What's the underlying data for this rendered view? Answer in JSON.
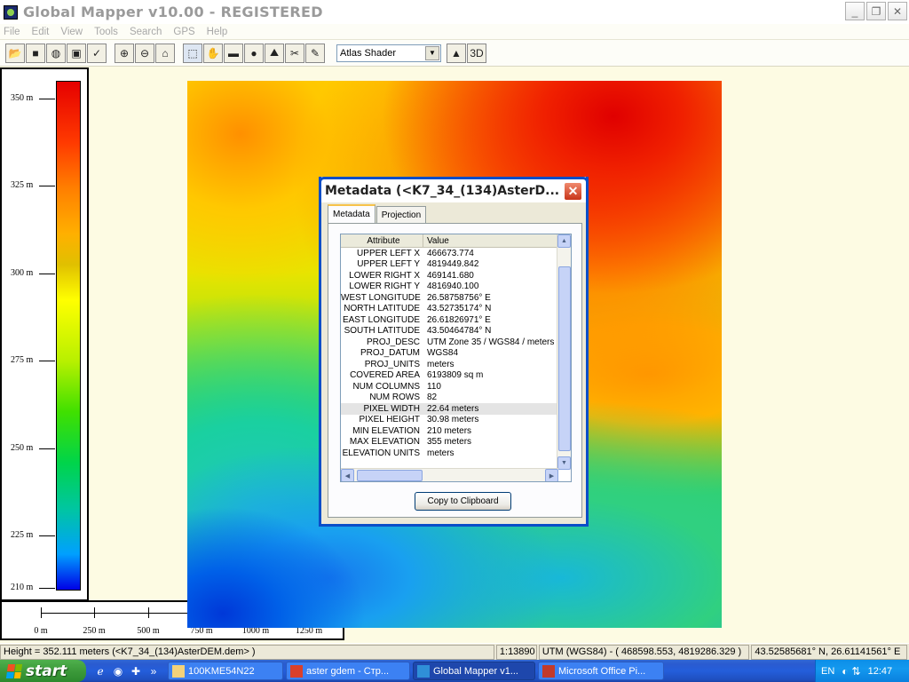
{
  "window": {
    "title": "Global Mapper v10.00 - REGISTERED",
    "buttons": [
      "_",
      "❐",
      "✕"
    ]
  },
  "menu": [
    "File",
    "Edit",
    "View",
    "Tools",
    "Search",
    "GPS",
    "Help"
  ],
  "toolbar": {
    "shader": "Atlas Shader"
  },
  "legend": {
    "labels": [
      "350 m",
      "325 m",
      "300 m",
      "275 m",
      "250 m",
      "225 m",
      "210 m"
    ]
  },
  "scale": {
    "labels": [
      "0 m",
      "250 m",
      "500 m",
      "750 m",
      "1000 m",
      "1250 m"
    ]
  },
  "dialog": {
    "title": "Metadata (<K7_34_(134)AsterD...",
    "tabs": [
      "Metadata",
      "Projection"
    ],
    "columns": [
      "Attribute",
      "Value"
    ],
    "rows": [
      {
        "attr": "UPPER LEFT X",
        "value": "466673.774"
      },
      {
        "attr": "UPPER LEFT Y",
        "value": "4819449.842"
      },
      {
        "attr": "LOWER RIGHT X",
        "value": "469141.680"
      },
      {
        "attr": "LOWER RIGHT Y",
        "value": "4816940.100"
      },
      {
        "attr": "WEST LONGITUDE",
        "value": "26.58758756° E"
      },
      {
        "attr": "NORTH LATITUDE",
        "value": "43.52735174° N"
      },
      {
        "attr": "EAST LONGITUDE",
        "value": "26.61826971° E"
      },
      {
        "attr": "SOUTH LATITUDE",
        "value": "43.50464784° N"
      },
      {
        "attr": "PROJ_DESC",
        "value": "UTM Zone 35 / WGS84 / meters"
      },
      {
        "attr": "PROJ_DATUM",
        "value": "WGS84"
      },
      {
        "attr": "PROJ_UNITS",
        "value": "meters"
      },
      {
        "attr": "COVERED AREA",
        "value": "6193809 sq m"
      },
      {
        "attr": "NUM COLUMNS",
        "value": "110"
      },
      {
        "attr": "NUM ROWS",
        "value": "82"
      },
      {
        "attr": "PIXEL WIDTH",
        "value": "22.64 meters"
      },
      {
        "attr": "PIXEL HEIGHT",
        "value": "30.98 meters"
      },
      {
        "attr": "MIN ELEVATION",
        "value": "210 meters"
      },
      {
        "attr": "MAX ELEVATION",
        "value": "355 meters"
      },
      {
        "attr": "ELEVATION UNITS",
        "value": "meters"
      }
    ],
    "selected_row": 14,
    "copy_button": "Copy to Clipboard"
  },
  "status": {
    "height": "Height = 352.111 meters (<K7_34_(134)AsterDEM.dem> )",
    "scale": "1:13890",
    "projection": "UTM (WGS84) - ( 468598.553, 4819286.329 )",
    "latlon": "43.52585681° N, 26.61141561° E"
  },
  "taskbar": {
    "start": "start",
    "tasks": [
      {
        "label": "100KME54N22",
        "icon": "folder-icon",
        "color": "#f3d27a"
      },
      {
        "label": "aster gdem - Стр...",
        "icon": "browser-icon",
        "color": "#d9402b"
      },
      {
        "label": "Global Mapper v1...",
        "icon": "globe-icon",
        "color": "#2f8fd8"
      },
      {
        "label": "Microsoft Office Pi...",
        "icon": "office-picture-icon",
        "color": "#c23a2a"
      }
    ],
    "lang": "EN",
    "clock": "12:47"
  }
}
